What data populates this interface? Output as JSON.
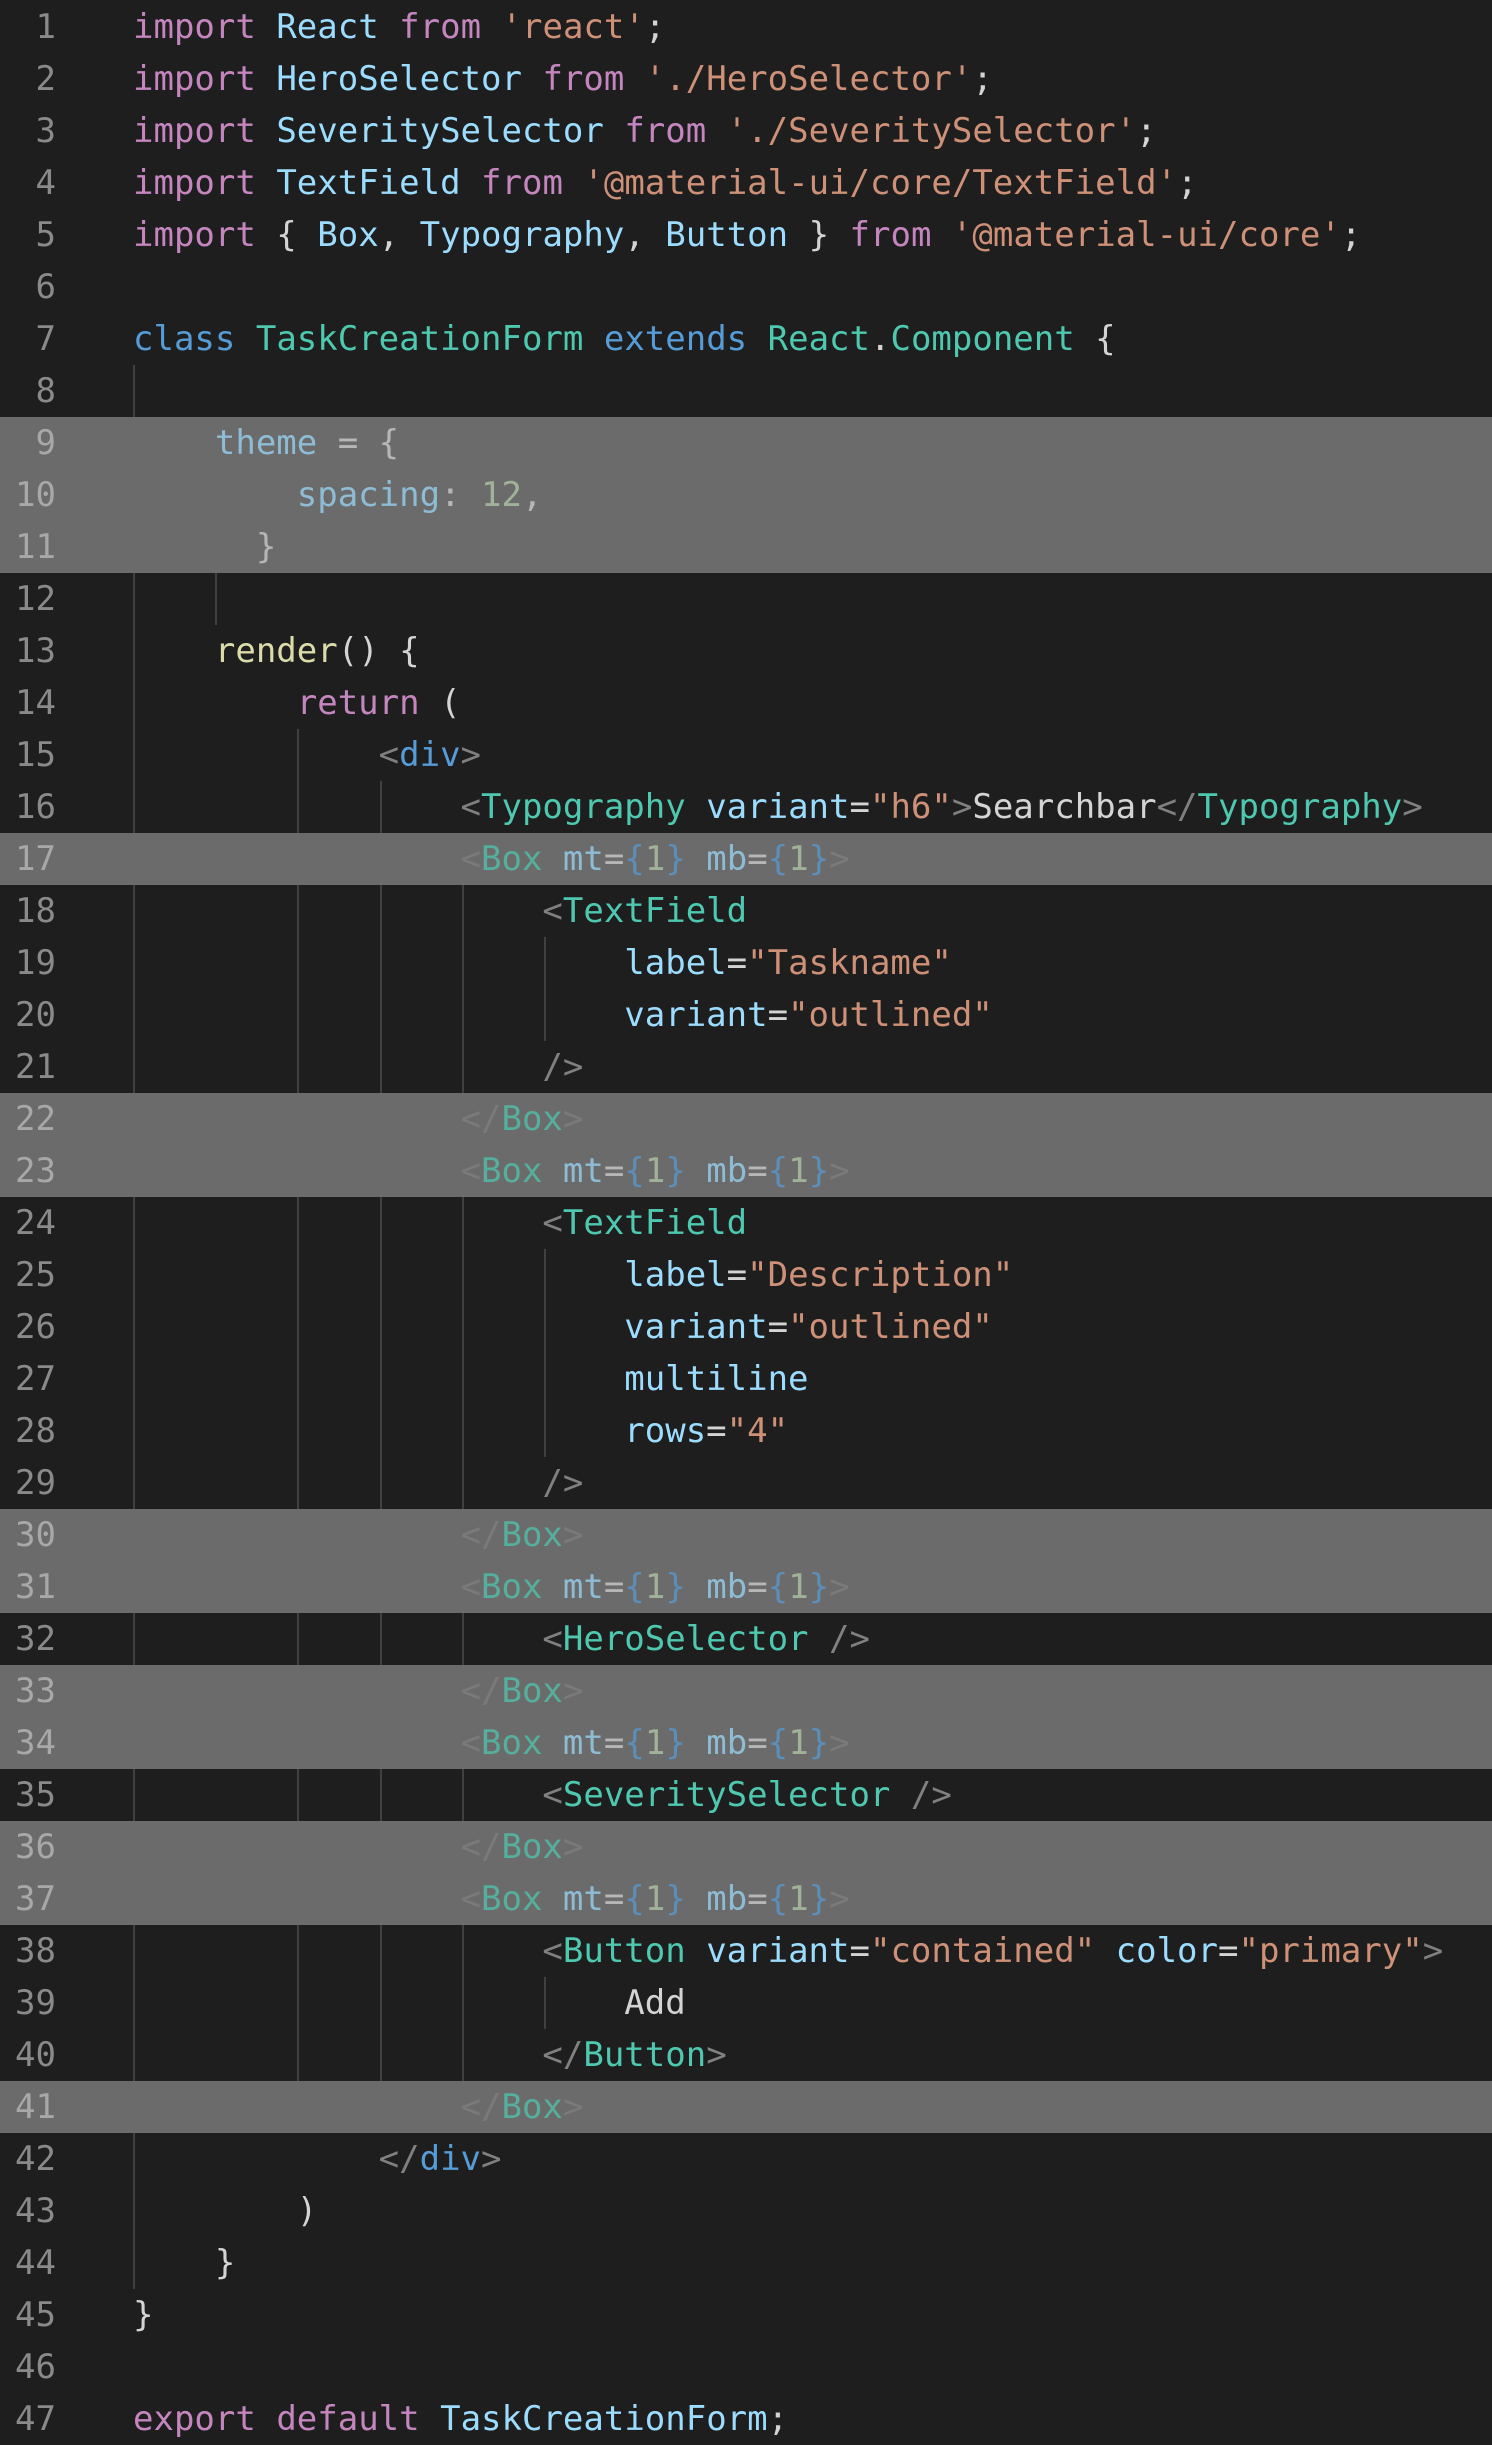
{
  "editor": {
    "colors": {
      "background": "#1e1e1e",
      "highlight": "#6b6b6b",
      "keyword": "#c586c0",
      "storage": "#569cd6",
      "identifier": "#9cdcfe",
      "class": "#4ec9b0",
      "string": "#ce9178",
      "function": "#dcdcaa",
      "number": "#b5cea8"
    },
    "highlighted_lines": [
      9,
      10,
      11,
      17,
      22,
      23,
      30,
      31,
      33,
      34,
      36,
      37,
      41
    ],
    "lines": [
      {
        "n": "1",
        "tokens": [
          [
            "kw",
            "import"
          ],
          [
            "pn",
            " "
          ],
          [
            "id",
            "React"
          ],
          [
            "pn",
            " "
          ],
          [
            "kw",
            "from"
          ],
          [
            "pn",
            " "
          ],
          [
            "st",
            "'react'"
          ],
          [
            "pn",
            ";"
          ]
        ]
      },
      {
        "n": "2",
        "tokens": [
          [
            "kw",
            "import"
          ],
          [
            "pn",
            " "
          ],
          [
            "id",
            "HeroSelector"
          ],
          [
            "pn",
            " "
          ],
          [
            "kw",
            "from"
          ],
          [
            "pn",
            " "
          ],
          [
            "st",
            "'./HeroSelector'"
          ],
          [
            "pn",
            ";"
          ]
        ]
      },
      {
        "n": "3",
        "tokens": [
          [
            "kw",
            "import"
          ],
          [
            "pn",
            " "
          ],
          [
            "id",
            "SeveritySelector"
          ],
          [
            "pn",
            " "
          ],
          [
            "kw",
            "from"
          ],
          [
            "pn",
            " "
          ],
          [
            "st",
            "'./SeveritySelector'"
          ],
          [
            "pn",
            ";"
          ]
        ]
      },
      {
        "n": "4",
        "tokens": [
          [
            "kw",
            "import"
          ],
          [
            "pn",
            " "
          ],
          [
            "id",
            "TextField"
          ],
          [
            "pn",
            " "
          ],
          [
            "kw",
            "from"
          ],
          [
            "pn",
            " "
          ],
          [
            "st",
            "'@material-ui/core/TextField'"
          ],
          [
            "pn",
            ";"
          ]
        ]
      },
      {
        "n": "5",
        "tokens": [
          [
            "kw",
            "import"
          ],
          [
            "pn",
            " { "
          ],
          [
            "id",
            "Box"
          ],
          [
            "pn",
            ", "
          ],
          [
            "id",
            "Typography"
          ],
          [
            "pn",
            ", "
          ],
          [
            "id",
            "Button"
          ],
          [
            "pn",
            " } "
          ],
          [
            "kw",
            "from"
          ],
          [
            "pn",
            " "
          ],
          [
            "st",
            "'@material-ui/core'"
          ],
          [
            "pn",
            ";"
          ]
        ]
      },
      {
        "n": "6",
        "tokens": []
      },
      {
        "n": "7",
        "tokens": [
          [
            "kb",
            "class"
          ],
          [
            "pn",
            " "
          ],
          [
            "cl",
            "TaskCreationForm"
          ],
          [
            "pn",
            " "
          ],
          [
            "kb",
            "extends"
          ],
          [
            "pn",
            " "
          ],
          [
            "cl",
            "React"
          ],
          [
            "pn",
            "."
          ],
          [
            "cl",
            "Component"
          ],
          [
            "pn",
            " {"
          ]
        ]
      },
      {
        "n": "8",
        "tokens": []
      },
      {
        "n": "9",
        "tokens": [
          [
            "pn",
            "    "
          ],
          [
            "id",
            "theme"
          ],
          [
            "pn",
            " = {"
          ]
        ]
      },
      {
        "n": "10",
        "tokens": [
          [
            "pn",
            "        "
          ],
          [
            "id",
            "spacing"
          ],
          [
            "pn",
            ": "
          ],
          [
            "nm",
            "12"
          ],
          [
            "pn",
            ","
          ]
        ]
      },
      {
        "n": "11",
        "tokens": [
          [
            "pn",
            "      }"
          ]
        ]
      },
      {
        "n": "12",
        "tokens": []
      },
      {
        "n": "13",
        "tokens": [
          [
            "pn",
            "    "
          ],
          [
            "fn",
            "render"
          ],
          [
            "pn",
            "() {"
          ]
        ]
      },
      {
        "n": "14",
        "tokens": [
          [
            "pn",
            "        "
          ],
          [
            "kw",
            "return"
          ],
          [
            "pn",
            " ("
          ]
        ]
      },
      {
        "n": "15",
        "tokens": [
          [
            "pn",
            "            "
          ],
          [
            "tg",
            "<"
          ],
          [
            "kb",
            "div"
          ],
          [
            "tg",
            ">"
          ]
        ]
      },
      {
        "n": "16",
        "tokens": [
          [
            "pn",
            "                "
          ],
          [
            "tg",
            "<"
          ],
          [
            "cl",
            "Typography"
          ],
          [
            "pn",
            " "
          ],
          [
            "id",
            "variant"
          ],
          [
            "pn",
            "="
          ],
          [
            "st",
            "\"h6\""
          ],
          [
            "tg",
            ">"
          ],
          [
            "pn",
            "Searchbar"
          ],
          [
            "tg",
            "</"
          ],
          [
            "cl",
            "Typography"
          ],
          [
            "tg",
            ">"
          ]
        ]
      },
      {
        "n": "17",
        "tokens": [
          [
            "pn",
            "                "
          ],
          [
            "tg",
            "<"
          ],
          [
            "cl",
            "Box"
          ],
          [
            "pn",
            " "
          ],
          [
            "id",
            "mt"
          ],
          [
            "pn",
            "="
          ],
          [
            "kb",
            "{"
          ],
          [
            "nm",
            "1"
          ],
          [
            "kb",
            "}"
          ],
          [
            "pn",
            " "
          ],
          [
            "id",
            "mb"
          ],
          [
            "pn",
            "="
          ],
          [
            "kb",
            "{"
          ],
          [
            "nm",
            "1"
          ],
          [
            "kb",
            "}"
          ],
          [
            "tg",
            ">"
          ]
        ]
      },
      {
        "n": "18",
        "tokens": [
          [
            "pn",
            "                    "
          ],
          [
            "tg",
            "<"
          ],
          [
            "cl",
            "TextField"
          ]
        ]
      },
      {
        "n": "19",
        "tokens": [
          [
            "pn",
            "                        "
          ],
          [
            "id",
            "label"
          ],
          [
            "pn",
            "="
          ],
          [
            "st",
            "\"Taskname\""
          ]
        ]
      },
      {
        "n": "20",
        "tokens": [
          [
            "pn",
            "                        "
          ],
          [
            "id",
            "variant"
          ],
          [
            "pn",
            "="
          ],
          [
            "st",
            "\"outlined\""
          ]
        ]
      },
      {
        "n": "21",
        "tokens": [
          [
            "pn",
            "                    "
          ],
          [
            "tg",
            "/>"
          ]
        ]
      },
      {
        "n": "22",
        "tokens": [
          [
            "pn",
            "                "
          ],
          [
            "tg",
            "</"
          ],
          [
            "cl",
            "Box"
          ],
          [
            "tg",
            ">"
          ]
        ]
      },
      {
        "n": "23",
        "tokens": [
          [
            "pn",
            "                "
          ],
          [
            "tg",
            "<"
          ],
          [
            "cl",
            "Box"
          ],
          [
            "pn",
            " "
          ],
          [
            "id",
            "mt"
          ],
          [
            "pn",
            "="
          ],
          [
            "kb",
            "{"
          ],
          [
            "nm",
            "1"
          ],
          [
            "kb",
            "}"
          ],
          [
            "pn",
            " "
          ],
          [
            "id",
            "mb"
          ],
          [
            "pn",
            "="
          ],
          [
            "kb",
            "{"
          ],
          [
            "nm",
            "1"
          ],
          [
            "kb",
            "}"
          ],
          [
            "tg",
            ">"
          ]
        ]
      },
      {
        "n": "24",
        "tokens": [
          [
            "pn",
            "                    "
          ],
          [
            "tg",
            "<"
          ],
          [
            "cl",
            "TextField"
          ]
        ]
      },
      {
        "n": "25",
        "tokens": [
          [
            "pn",
            "                        "
          ],
          [
            "id",
            "label"
          ],
          [
            "pn",
            "="
          ],
          [
            "st",
            "\"Description\""
          ]
        ]
      },
      {
        "n": "26",
        "tokens": [
          [
            "pn",
            "                        "
          ],
          [
            "id",
            "variant"
          ],
          [
            "pn",
            "="
          ],
          [
            "st",
            "\"outlined\""
          ]
        ]
      },
      {
        "n": "27",
        "tokens": [
          [
            "pn",
            "                        "
          ],
          [
            "id",
            "multiline"
          ]
        ]
      },
      {
        "n": "28",
        "tokens": [
          [
            "pn",
            "                        "
          ],
          [
            "id",
            "rows"
          ],
          [
            "pn",
            "="
          ],
          [
            "st",
            "\"4\""
          ]
        ]
      },
      {
        "n": "29",
        "tokens": [
          [
            "pn",
            "                    "
          ],
          [
            "tg",
            "/>"
          ]
        ]
      },
      {
        "n": "30",
        "tokens": [
          [
            "pn",
            "                "
          ],
          [
            "tg",
            "</"
          ],
          [
            "cl",
            "Box"
          ],
          [
            "tg",
            ">"
          ]
        ]
      },
      {
        "n": "31",
        "tokens": [
          [
            "pn",
            "                "
          ],
          [
            "tg",
            "<"
          ],
          [
            "cl",
            "Box"
          ],
          [
            "pn",
            " "
          ],
          [
            "id",
            "mt"
          ],
          [
            "pn",
            "="
          ],
          [
            "kb",
            "{"
          ],
          [
            "nm",
            "1"
          ],
          [
            "kb",
            "}"
          ],
          [
            "pn",
            " "
          ],
          [
            "id",
            "mb"
          ],
          [
            "pn",
            "="
          ],
          [
            "kb",
            "{"
          ],
          [
            "nm",
            "1"
          ],
          [
            "kb",
            "}"
          ],
          [
            "tg",
            ">"
          ]
        ]
      },
      {
        "n": "32",
        "tokens": [
          [
            "pn",
            "                    "
          ],
          [
            "tg",
            "<"
          ],
          [
            "cl",
            "HeroSelector"
          ],
          [
            "pn",
            " "
          ],
          [
            "tg",
            "/>"
          ]
        ]
      },
      {
        "n": "33",
        "tokens": [
          [
            "pn",
            "                "
          ],
          [
            "tg",
            "</"
          ],
          [
            "cl",
            "Box"
          ],
          [
            "tg",
            ">"
          ]
        ]
      },
      {
        "n": "34",
        "tokens": [
          [
            "pn",
            "                "
          ],
          [
            "tg",
            "<"
          ],
          [
            "cl",
            "Box"
          ],
          [
            "pn",
            " "
          ],
          [
            "id",
            "mt"
          ],
          [
            "pn",
            "="
          ],
          [
            "kb",
            "{"
          ],
          [
            "nm",
            "1"
          ],
          [
            "kb",
            "}"
          ],
          [
            "pn",
            " "
          ],
          [
            "id",
            "mb"
          ],
          [
            "pn",
            "="
          ],
          [
            "kb",
            "{"
          ],
          [
            "nm",
            "1"
          ],
          [
            "kb",
            "}"
          ],
          [
            "tg",
            ">"
          ]
        ]
      },
      {
        "n": "35",
        "tokens": [
          [
            "pn",
            "                    "
          ],
          [
            "tg",
            "<"
          ],
          [
            "cl",
            "SeveritySelector"
          ],
          [
            "pn",
            " "
          ],
          [
            "tg",
            "/>"
          ]
        ]
      },
      {
        "n": "36",
        "tokens": [
          [
            "pn",
            "                "
          ],
          [
            "tg",
            "</"
          ],
          [
            "cl",
            "Box"
          ],
          [
            "tg",
            ">"
          ]
        ]
      },
      {
        "n": "37",
        "tokens": [
          [
            "pn",
            "                "
          ],
          [
            "tg",
            "<"
          ],
          [
            "cl",
            "Box"
          ],
          [
            "pn",
            " "
          ],
          [
            "id",
            "mt"
          ],
          [
            "pn",
            "="
          ],
          [
            "kb",
            "{"
          ],
          [
            "nm",
            "1"
          ],
          [
            "kb",
            "}"
          ],
          [
            "pn",
            " "
          ],
          [
            "id",
            "mb"
          ],
          [
            "pn",
            "="
          ],
          [
            "kb",
            "{"
          ],
          [
            "nm",
            "1"
          ],
          [
            "kb",
            "}"
          ],
          [
            "tg",
            ">"
          ]
        ]
      },
      {
        "n": "38",
        "tokens": [
          [
            "pn",
            "                    "
          ],
          [
            "tg",
            "<"
          ],
          [
            "cl",
            "Button"
          ],
          [
            "pn",
            " "
          ],
          [
            "id",
            "variant"
          ],
          [
            "pn",
            "="
          ],
          [
            "st",
            "\"contained\""
          ],
          [
            "pn",
            " "
          ],
          [
            "id",
            "color"
          ],
          [
            "pn",
            "="
          ],
          [
            "st",
            "\"primary\""
          ],
          [
            "tg",
            ">"
          ]
        ]
      },
      {
        "n": "39",
        "tokens": [
          [
            "pn",
            "                        Add"
          ]
        ]
      },
      {
        "n": "40",
        "tokens": [
          [
            "pn",
            "                    "
          ],
          [
            "tg",
            "</"
          ],
          [
            "cl",
            "Button"
          ],
          [
            "tg",
            ">"
          ]
        ]
      },
      {
        "n": "41",
        "tokens": [
          [
            "pn",
            "                "
          ],
          [
            "tg",
            "</"
          ],
          [
            "cl",
            "Box"
          ],
          [
            "tg",
            ">"
          ]
        ]
      },
      {
        "n": "42",
        "tokens": [
          [
            "pn",
            "            "
          ],
          [
            "tg",
            "</"
          ],
          [
            "kb",
            "div"
          ],
          [
            "tg",
            ">"
          ]
        ]
      },
      {
        "n": "43",
        "tokens": [
          [
            "pn",
            "        )"
          ]
        ]
      },
      {
        "n": "44",
        "tokens": [
          [
            "pn",
            "    }"
          ]
        ]
      },
      {
        "n": "45",
        "tokens": [
          [
            "pn",
            "}"
          ]
        ]
      },
      {
        "n": "46",
        "tokens": []
      },
      {
        "n": "47",
        "tokens": [
          [
            "kw",
            "export"
          ],
          [
            "pn",
            " "
          ],
          [
            "kw",
            "default"
          ],
          [
            "pn",
            " "
          ],
          [
            "id",
            "TaskCreationForm"
          ],
          [
            "pn",
            ";"
          ]
        ]
      }
    ]
  }
}
